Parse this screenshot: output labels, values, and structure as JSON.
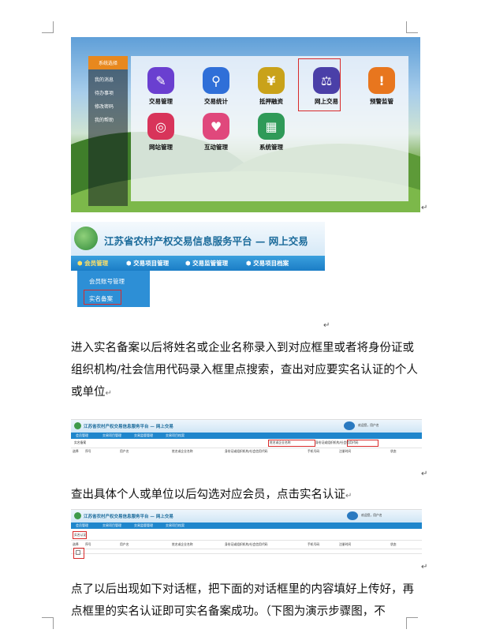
{
  "doc": {
    "para1": "进入实名备案以后将姓名或企业名称录入到对应框里或者将身份证或组织机构/社会信用代码录入框里点搜索，查出对应要实名认证的个人或单位",
    "para2": "查出具体个人或单位以后勾选对应会员，点击实名认证",
    "para3": "点了以后出现如下对话框，把下面的对话框里的内容填好上传好，再点框里的实名认证即可实名备案成功。（下图为演示步骤图，不",
    "para_mark": "↵",
    "arrow_mark": "↵"
  },
  "home_shot": {
    "sidebar": [
      "系统选择",
      "我的消息",
      "待办事项",
      "修改密码",
      "我的帮助"
    ],
    "tiles": [
      {
        "label": "交易管理",
        "icon": "edit-icon",
        "color": "#6a3fd0",
        "glyph": "✎"
      },
      {
        "label": "交易统计",
        "icon": "search-icon",
        "color": "#2f6fd8",
        "glyph": "⚲"
      },
      {
        "label": "抵押融资",
        "icon": "yen-icon",
        "color": "#c9a21a",
        "glyph": "¥"
      },
      {
        "label": "网上交易",
        "icon": "gavel-icon",
        "color": "#4a3fa8",
        "glyph": "⚖"
      },
      {
        "label": "预警监管",
        "icon": "warning-shield-icon",
        "color": "#e8761e",
        "glyph": "!"
      },
      {
        "label": "网站管理",
        "icon": "globe-icon",
        "color": "#d8345a",
        "glyph": "◎"
      },
      {
        "label": "互动管理",
        "icon": "heart-icon",
        "color": "#e0487c",
        "glyph": "♥"
      },
      {
        "label": "系统管理",
        "icon": "grid-icon",
        "color": "#2f9a58",
        "glyph": "▦"
      }
    ]
  },
  "menu_shot": {
    "title": "江苏省农村产权交易信息服务平台 — 网上交易",
    "nav": [
      "会员管理",
      "交易项目管理",
      "交易监管管理",
      "交易项目档案"
    ],
    "dropdown": [
      "会员账号管理",
      "实名备案"
    ]
  },
  "search_shot": {
    "title": "江苏省农村产权交易信息服务平台 — 网上交易",
    "user": "欢迎您，用户名",
    "nav": [
      "会员管理",
      "交易项目管理",
      "交易监管管理",
      "交易项目档案"
    ],
    "tab": "实名备案",
    "search_name": "姓名或企业名称",
    "search_id": "身份证或组织机构/社会信用代码",
    "columns": [
      "选择",
      "序号",
      "用户名",
      "姓名或企业名称",
      "身份证或组织机构/社会信用代码",
      "手机号码",
      "注册时间",
      "状态"
    ]
  },
  "result_shot": {
    "title": "江苏省农村产权交易信息服务平台 — 网上交易",
    "user": "欢迎您，用户名",
    "nav": [
      "会员管理",
      "交易项目管理",
      "交易监管管理",
      "交易项目档案"
    ],
    "action": "实名认证",
    "columns": [
      "选择",
      "序号",
      "用户名",
      "姓名或企业名称",
      "身份证或组织机构/社会信用代码",
      "手机号码",
      "注册时间",
      "状态"
    ]
  }
}
